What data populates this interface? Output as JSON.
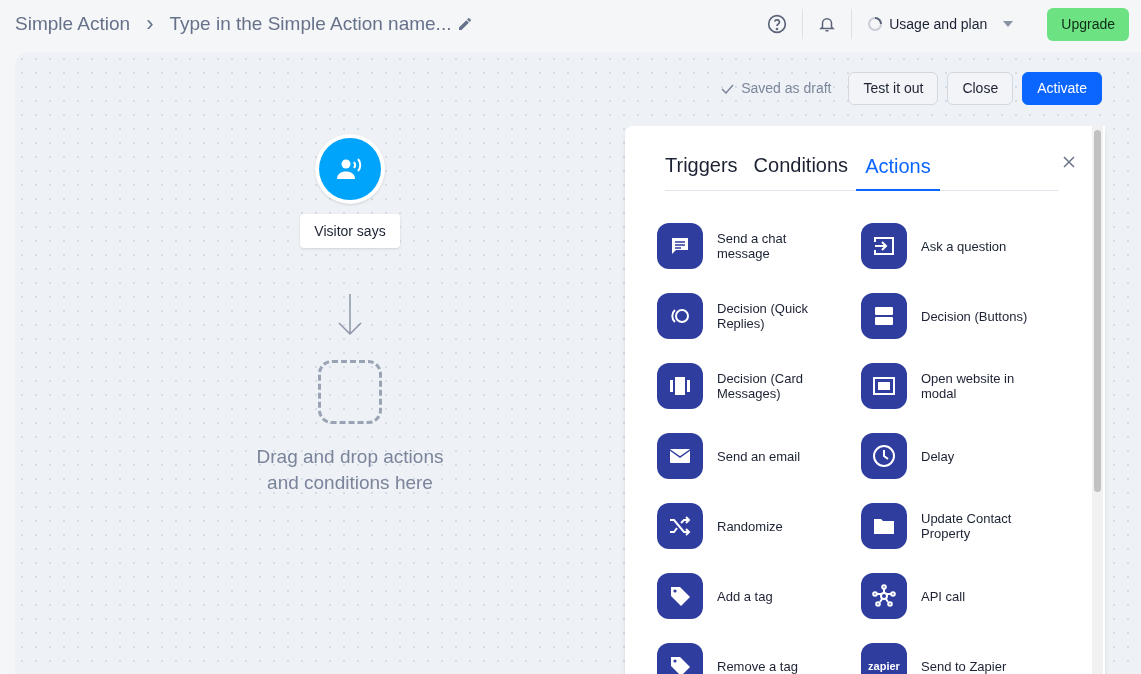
{
  "breadcrumb": {
    "parent": "Simple Action",
    "separator": "›",
    "name_placeholder": "Type in the Simple Action name..."
  },
  "header": {
    "plan_label": "Usage and plan",
    "upgrade": "Upgrade"
  },
  "toolbar": {
    "status": "Saved as draft",
    "buttons": [
      {
        "label": "Test it out",
        "kind": "secondary"
      },
      {
        "label": "Close",
        "kind": "secondary"
      },
      {
        "label": "Activate",
        "kind": "primary"
      }
    ]
  },
  "canvas": {
    "trigger_label": "Visitor says",
    "drop_hint": "Drag and drop actions\nand conditions here"
  },
  "panel": {
    "tabs": [
      {
        "label": "Triggers",
        "selected": false
      },
      {
        "label": "Conditions",
        "selected": false
      },
      {
        "label": "Actions",
        "selected": true
      }
    ],
    "items": [
      {
        "label": "Send a chat message"
      },
      {
        "label": "Ask a question"
      },
      {
        "label": "Decision (Quick Replies)"
      },
      {
        "label": "Decision (Buttons)"
      },
      {
        "label": "Decision (Card Messages)"
      },
      {
        "label": "Open website in modal"
      },
      {
        "label": "Send an email"
      },
      {
        "label": "Delay"
      },
      {
        "label": "Randomize"
      },
      {
        "label": "Update Contact Property"
      },
      {
        "label": "Add a tag"
      },
      {
        "label": "API call"
      },
      {
        "label": "Remove a tag"
      },
      {
        "label": "Send to Zapier",
        "badge_text": "zapier"
      }
    ]
  }
}
